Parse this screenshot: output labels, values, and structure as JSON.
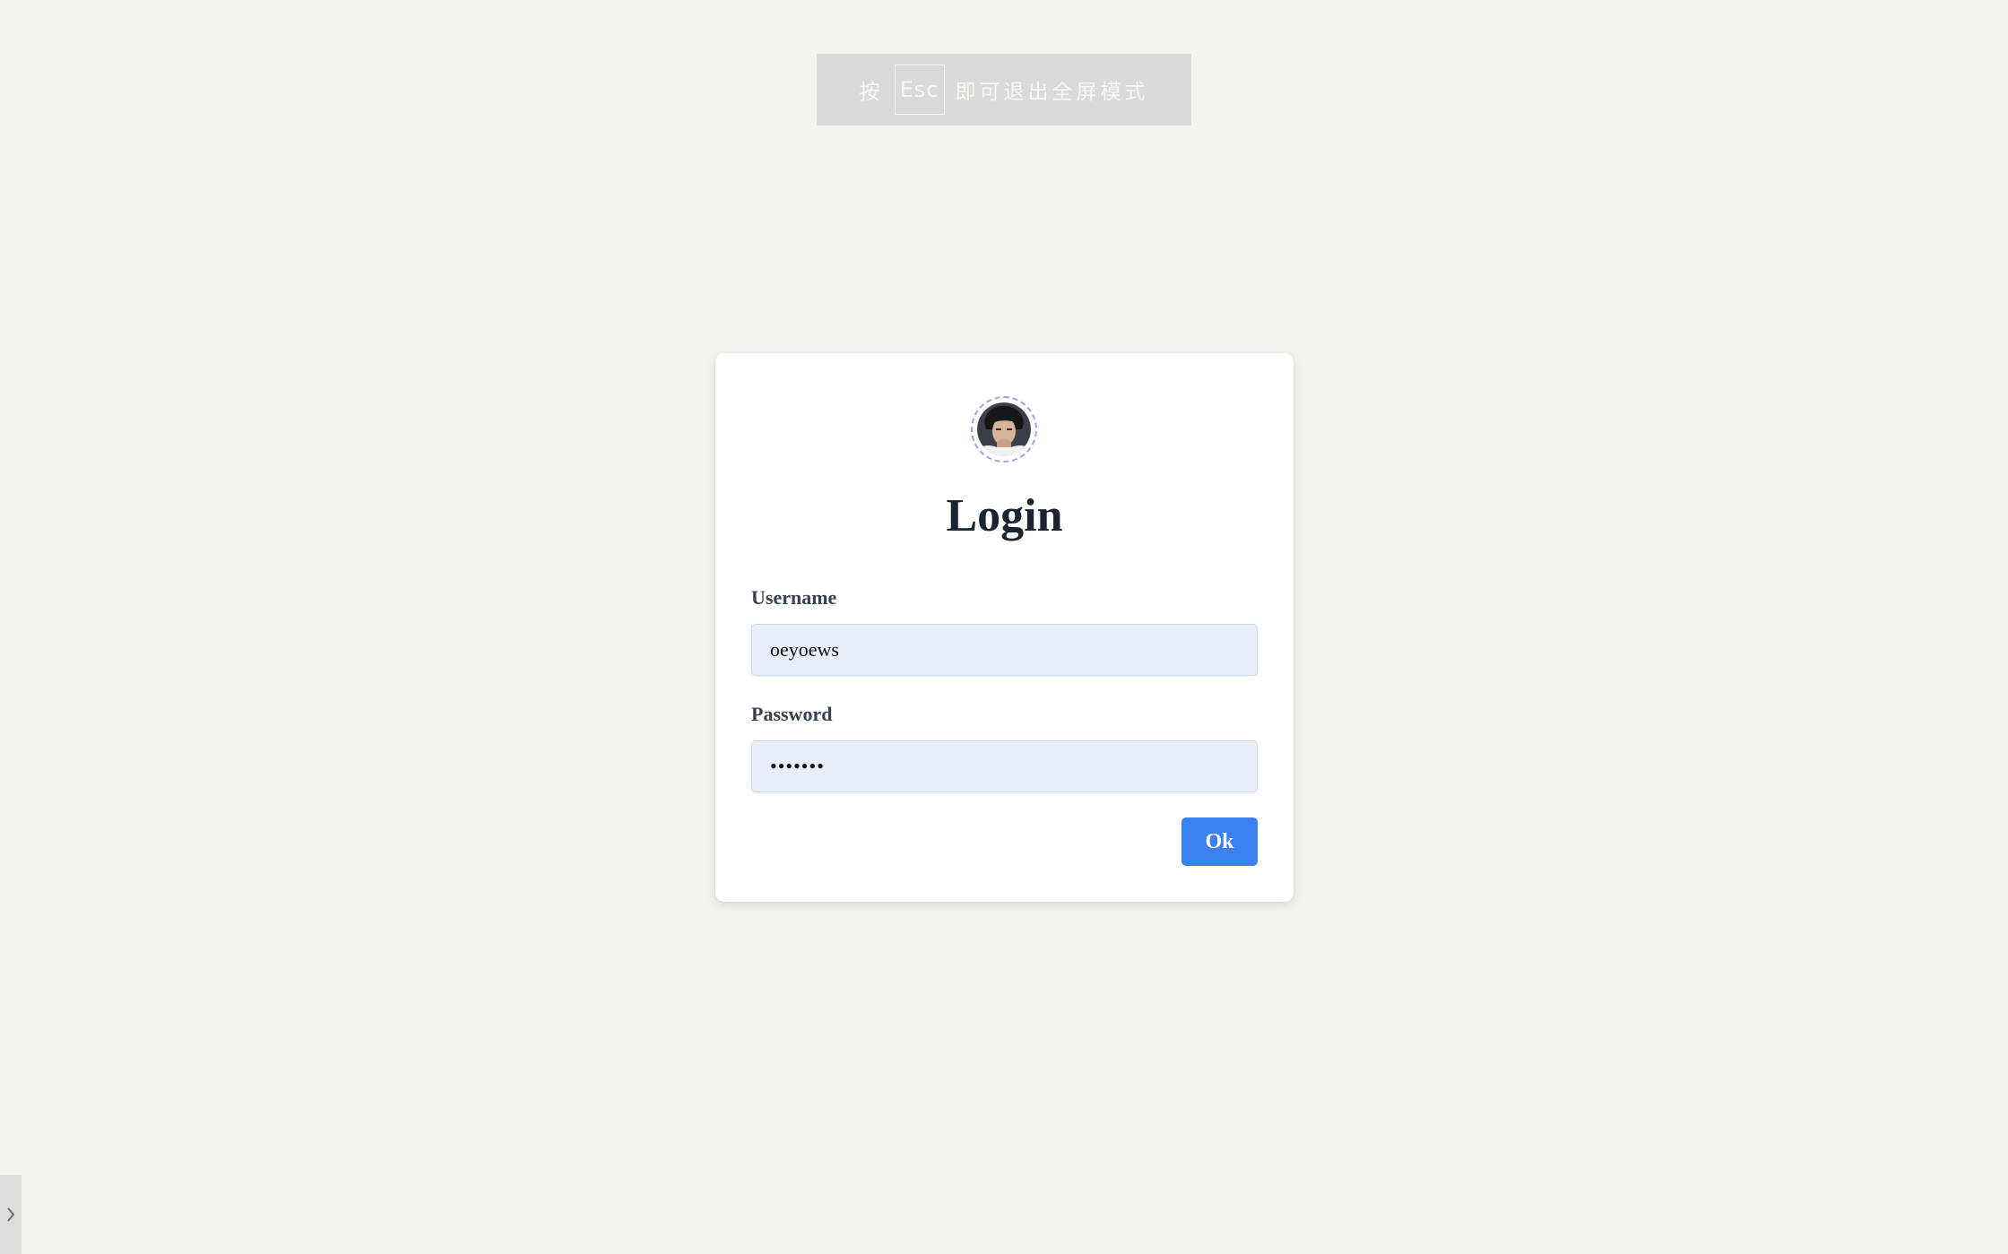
{
  "fullscreen_notice": {
    "prefix": "按",
    "key": "Esc",
    "suffix": "即可退出全屏模式"
  },
  "login": {
    "title": "Login",
    "username_label": "Username",
    "username_value": "oeyoews",
    "password_label": "Password",
    "password_value": "•••••••",
    "submit_label": "Ok"
  },
  "icons": {
    "avatar": "user-avatar-photo",
    "side_toggle": "chevron-right-icon"
  },
  "colors": {
    "background": "#f4f4ef",
    "card": "#ffffff",
    "input_bg": "#e8effb",
    "button": "#3b82f0",
    "title": "#1c2433"
  }
}
